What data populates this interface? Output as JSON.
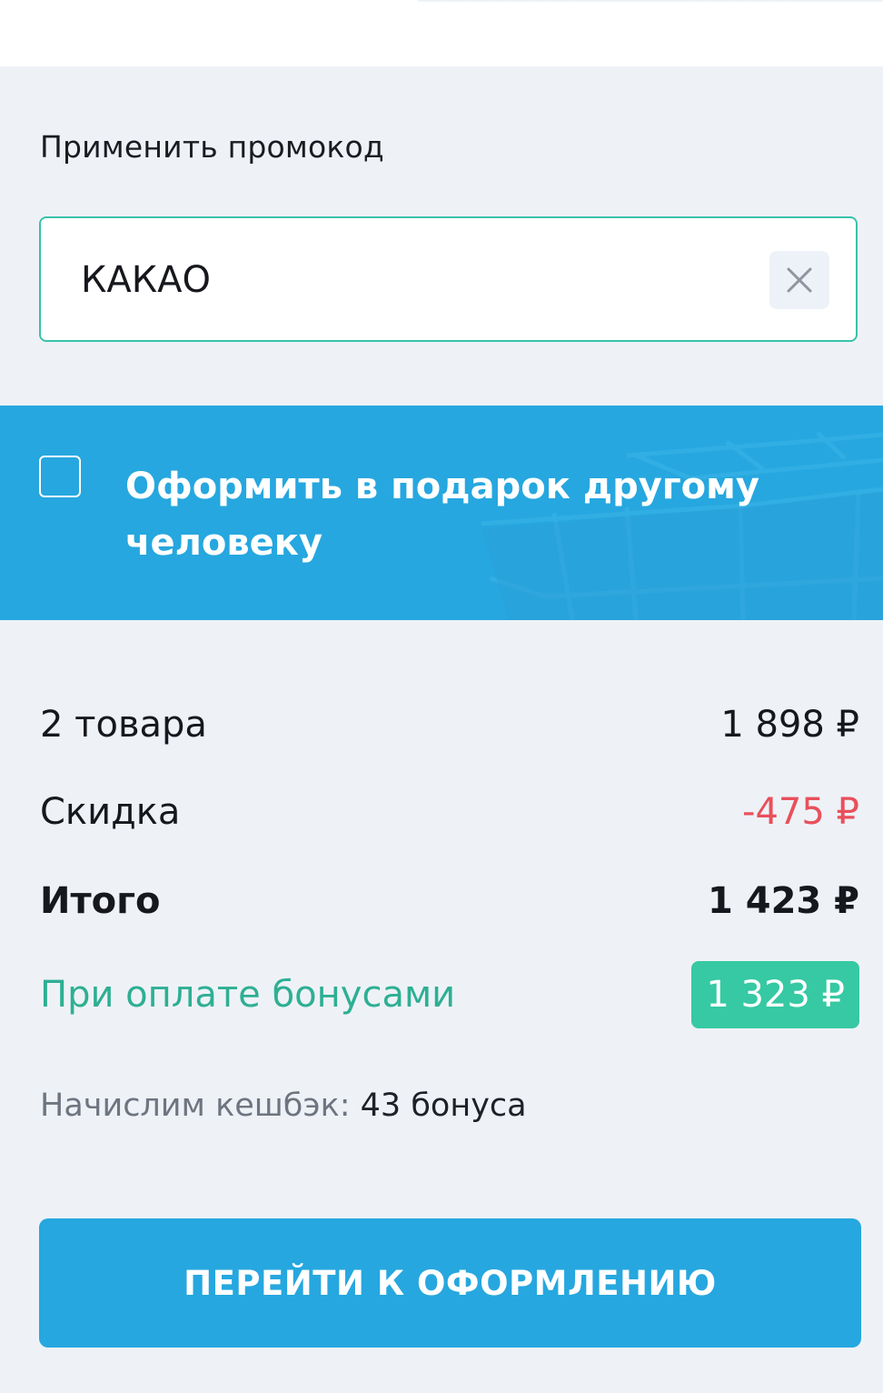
{
  "promo": {
    "title": "Применить промокод",
    "code_value": "КАКАО",
    "clear_icon": "close-icon"
  },
  "gift": {
    "checked": false,
    "label": "Оформить в подарок другому человеку"
  },
  "summary": {
    "items_label": "2 товара",
    "items_value": "1 898 ₽",
    "discount_label": "Скидка",
    "discount_value": "-475 ₽",
    "total_label": "Итого",
    "total_value": "1 423 ₽",
    "bonus_label": "При оплате бонусами",
    "bonus_value": "1 323 ₽"
  },
  "cashback": {
    "label": "Начислим кешбэк:",
    "value": "43 бонуса"
  },
  "checkout": {
    "label": "ПЕРЕЙТИ К ОФОРМЛЕНИЮ"
  },
  "colors": {
    "accent_blue": "#26a7df",
    "accent_green": "#36c9a3",
    "discount_red": "#e8505b",
    "background": "#eef2f7"
  }
}
